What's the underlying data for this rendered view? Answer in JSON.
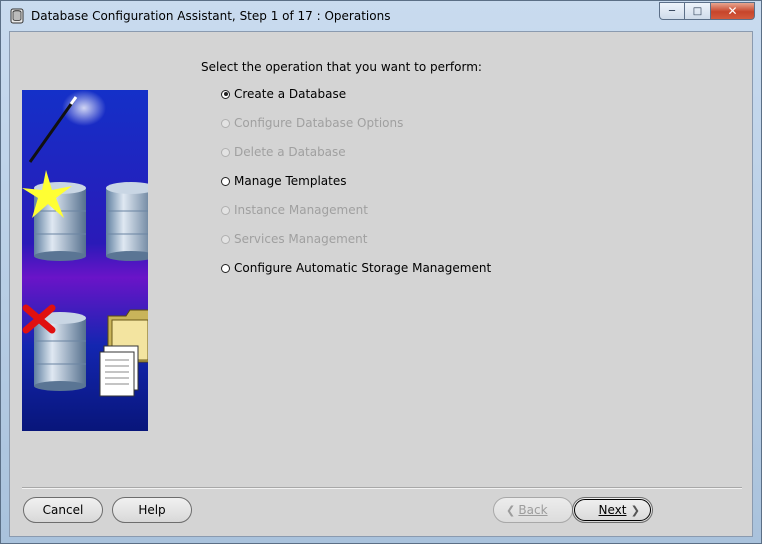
{
  "window": {
    "title": "Database Configuration Assistant, Step 1 of 17 : Operations"
  },
  "icons": {
    "app": "oracle-dbca-app-icon",
    "minimize": "minimize-icon",
    "maximize": "maximize-icon",
    "close": "close-icon"
  },
  "main": {
    "prompt": "Select the operation that you want to perform:",
    "options": [
      {
        "label": "Create a Database",
        "enabled": true,
        "selected": true
      },
      {
        "label": "Configure Database Options",
        "enabled": false,
        "selected": false
      },
      {
        "label": "Delete a Database",
        "enabled": false,
        "selected": false
      },
      {
        "label": "Manage Templates",
        "enabled": true,
        "selected": false
      },
      {
        "label": "Instance Management",
        "enabled": false,
        "selected": false
      },
      {
        "label": "Services Management",
        "enabled": false,
        "selected": false
      },
      {
        "label": "Configure Automatic Storage Management",
        "enabled": true,
        "selected": false
      }
    ]
  },
  "footer": {
    "cancel": "Cancel",
    "help": "Help",
    "back": "Back",
    "next": "Next"
  },
  "colors": {
    "client_bg": "#d4d4d4",
    "disabled_text": "#a0a0a0",
    "illustration_blue": "#0a1fa8",
    "illustration_purple": "#6a14c8"
  }
}
